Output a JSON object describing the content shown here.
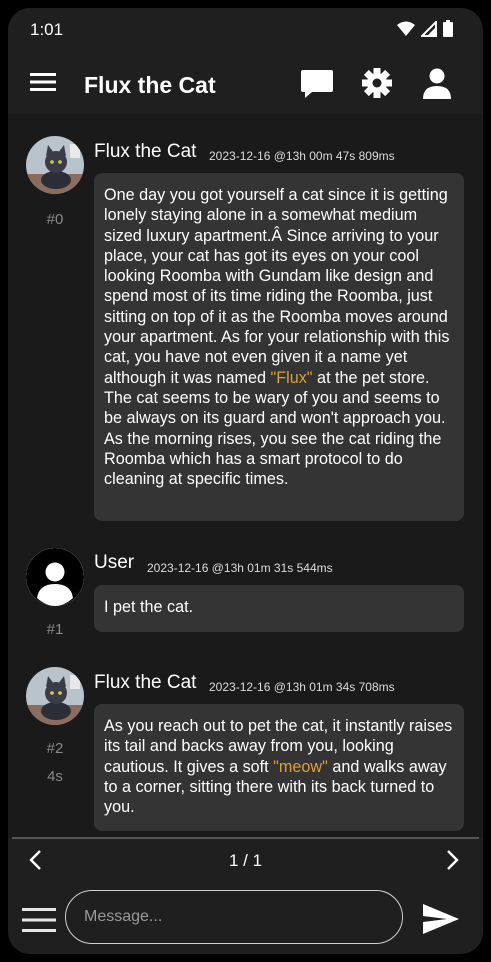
{
  "status": {
    "time": "1:01"
  },
  "appbar": {
    "title": "Flux the Cat"
  },
  "messages": [
    {
      "sender": "Flux the Cat",
      "timestamp": "2023-12-16 @13h 00m 47s 809ms",
      "index": "#0",
      "avatar": "cat-avatar",
      "text_before": "One day you got yourself a cat since it is getting lonely staying alone in a somewhat medium sized luxury apartment.Â Since arriving to your place, your cat has got its eyes on your cool looking Roomba with Gundam like design and spend most of its time riding the Roomba, just sitting on top of it as the Roomba moves around your apartment. As for your relationship with this cat, you have not even given it a name yet although it was named ",
      "highlight": "\"Flux\"",
      "text_after": " at the pet store. The cat seems to be wary of you and seems to be always on its guard and won't approach you. As the morning rises, you see the cat riding the Roomba which has a smart protocol to do cleaning at specific times."
    },
    {
      "sender": "User",
      "timestamp": "2023-12-16 @13h 01m 31s 544ms",
      "index": "#1",
      "avatar": "user-avatar",
      "text": "I pet the cat."
    },
    {
      "sender": "Flux the Cat",
      "timestamp": "2023-12-16 @13h 01m 34s 708ms",
      "index": "#2",
      "duration": "4s",
      "avatar": "cat-avatar",
      "text_before": "As you reach out to pet the cat, it instantly raises its tail and backs away from you, looking cautious. It gives a soft ",
      "highlight": "\"meow\"",
      "text_after": " and walks away to a corner, sitting there with its back turned to you."
    }
  ],
  "pager": {
    "page": "1 / 1"
  },
  "composer": {
    "placeholder": "Message..."
  },
  "colors": {
    "highlight": "#e0a030",
    "bubble": "#343434",
    "background": "#1a1a1a"
  }
}
